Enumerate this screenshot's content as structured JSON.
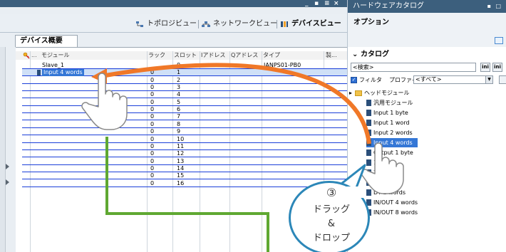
{
  "window": {
    "left_controls": [
      "_",
      "▪",
      "≡",
      "×"
    ],
    "right_title": "ハードウェアカタログ",
    "right_controls": [
      "▪",
      "□"
    ]
  },
  "view_tabs": [
    {
      "label": "トポロジビュー",
      "icon": "topology-icon",
      "active": false
    },
    {
      "label": "ネットワークビュー",
      "icon": "network-icon",
      "active": false
    },
    {
      "label": "デバイスビュー",
      "icon": "device-icon",
      "active": true
    }
  ],
  "device_overview": {
    "tab_label": "デバイス概要",
    "columns": [
      "モジュール",
      "ラック",
      "スロット",
      "Iアドレス",
      "Qアドレス",
      "タイプ",
      "製..."
    ],
    "rows": [
      {
        "module": "Slave_1",
        "rack": "",
        "slot": "0",
        "i_address": "",
        "q_address": "",
        "type": "IANPS01-PB0"
      },
      {
        "module": "Input 4 words",
        "rack": "0",
        "slot": "1",
        "i_address": "",
        "q_address": "",
        "type": ""
      },
      {
        "module": "",
        "rack": "0",
        "slot": "2",
        "i_address": "",
        "q_address": "",
        "type": ""
      },
      {
        "module": "",
        "rack": "0",
        "slot": "3",
        "i_address": "",
        "q_address": "",
        "type": ""
      },
      {
        "module": "",
        "rack": "0",
        "slot": "4",
        "i_address": "",
        "q_address": "",
        "type": ""
      },
      {
        "module": "",
        "rack": "0",
        "slot": "5",
        "i_address": "",
        "q_address": "",
        "type": ""
      },
      {
        "module": "",
        "rack": "0",
        "slot": "6",
        "i_address": "",
        "q_address": "",
        "type": ""
      },
      {
        "module": "",
        "rack": "0",
        "slot": "7",
        "i_address": "",
        "q_address": "",
        "type": ""
      },
      {
        "module": "",
        "rack": "0",
        "slot": "8",
        "i_address": "",
        "q_address": "",
        "type": ""
      },
      {
        "module": "",
        "rack": "0",
        "slot": "9",
        "i_address": "",
        "q_address": "",
        "type": ""
      },
      {
        "module": "",
        "rack": "0",
        "slot": "10",
        "i_address": "",
        "q_address": "",
        "type": ""
      },
      {
        "module": "",
        "rack": "0",
        "slot": "11",
        "i_address": "",
        "q_address": "",
        "type": ""
      },
      {
        "module": "",
        "rack": "0",
        "slot": "12",
        "i_address": "",
        "q_address": "",
        "type": ""
      },
      {
        "module": "",
        "rack": "0",
        "slot": "13",
        "i_address": "",
        "q_address": "",
        "type": ""
      },
      {
        "module": "",
        "rack": "0",
        "slot": "14",
        "i_address": "",
        "q_address": "",
        "type": ""
      },
      {
        "module": "",
        "rack": "0",
        "slot": "15",
        "i_address": "",
        "q_address": "",
        "type": ""
      },
      {
        "module": "",
        "rack": "0",
        "slot": "16",
        "i_address": "",
        "q_address": "",
        "type": ""
      }
    ]
  },
  "options": {
    "title": "オプション"
  },
  "catalog": {
    "title": "カタログ",
    "search_text": "<検索>",
    "search_buttons": [
      "ini",
      "ini"
    ],
    "filter_label": "フィルタ",
    "profile_label": "プロファイル",
    "profile_value": "<すべて>",
    "items": [
      {
        "label": "ヘッドモジュール",
        "icon": "folder-icon",
        "selected": false
      },
      {
        "label": "汎用モジュール",
        "icon": "module-icon",
        "selected": false
      },
      {
        "label": "Input 1 byte",
        "icon": "module-icon",
        "selected": false
      },
      {
        "label": "Input 1 word",
        "icon": "module-icon",
        "selected": false
      },
      {
        "label": "Input 2 words",
        "icon": "module-icon",
        "selected": false
      },
      {
        "label": "Input 4 words",
        "icon": "module-icon",
        "selected": true
      },
      {
        "label": "Output 1 byte",
        "icon": "module-icon",
        "selected": false
      },
      {
        "label": "1 words",
        "icon": "module-icon",
        "selected": false
      },
      {
        "label": "2 words",
        "icon": "module-icon",
        "selected": false
      },
      {
        "label": "4 words",
        "icon": "module-icon",
        "selected": false
      },
      {
        "label": "DT 2 words",
        "icon": "module-icon",
        "selected": false
      },
      {
        "label": "IN/OUT 4 words",
        "icon": "module-icon",
        "selected": false
      },
      {
        "label": "IN/OUT 8 words",
        "icon": "module-icon",
        "selected": false
      }
    ]
  },
  "callout": {
    "step": "③",
    "line1": "ドラッグ",
    "line2": "&",
    "line3": "ドロップ"
  },
  "colors": {
    "arrow": "#f07828",
    "green_line": "#5fa832",
    "callout_border": "#2c87b8",
    "selection": "#3477d6",
    "row_border": "#1b3fd9"
  }
}
